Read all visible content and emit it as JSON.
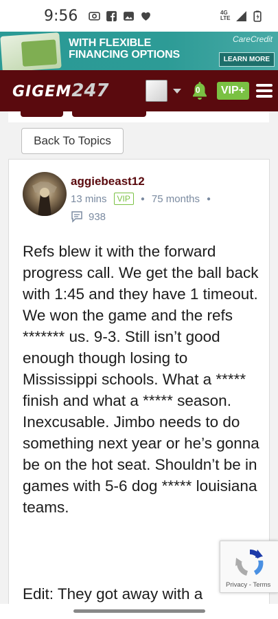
{
  "status_bar": {
    "time": "9:56",
    "network": "4G LTE"
  },
  "ad": {
    "headline_line1": "WITH FLEXIBLE",
    "headline_line2": "FINANCING OPTIONS",
    "brand": "CareCredit",
    "cta": "LEARN MORE",
    "color": "#2a9a95"
  },
  "header": {
    "logo_main": "GIGEM",
    "logo_suffix": "247",
    "notification_count": "0",
    "vip_label": "VIP+",
    "color": "#5a0a0e"
  },
  "back_button": {
    "label": "Back To Topics"
  },
  "post": {
    "username": "aggiebeast12",
    "time_ago": "13 mins",
    "vip_badge": "VIP",
    "member_age": "75 months",
    "views": "938",
    "body": "Refs blew it with the forward progress call. We get the ball back with 1:45 and they have 1 timeout. We won the game and the refs ******* us. 9-3. Still isn’t good enough though losing to Mississippi schools. What a ***** finish and what a ***** season. Inexcusable. Jimbo needs to do something next year or he’s gonna be on the hot seat. Shouldn’t be in games with 5-6 dog ***** louisiana teams.",
    "edit_partial": "Edit: They got away with a"
  },
  "recaptcha": {
    "privacy": "Privacy",
    "separator": "-",
    "terms": "Terms"
  },
  "colors": {
    "accent_green": "#7ac143",
    "maroon": "#5a0a0e",
    "meta_gray": "#7a8aa0"
  }
}
